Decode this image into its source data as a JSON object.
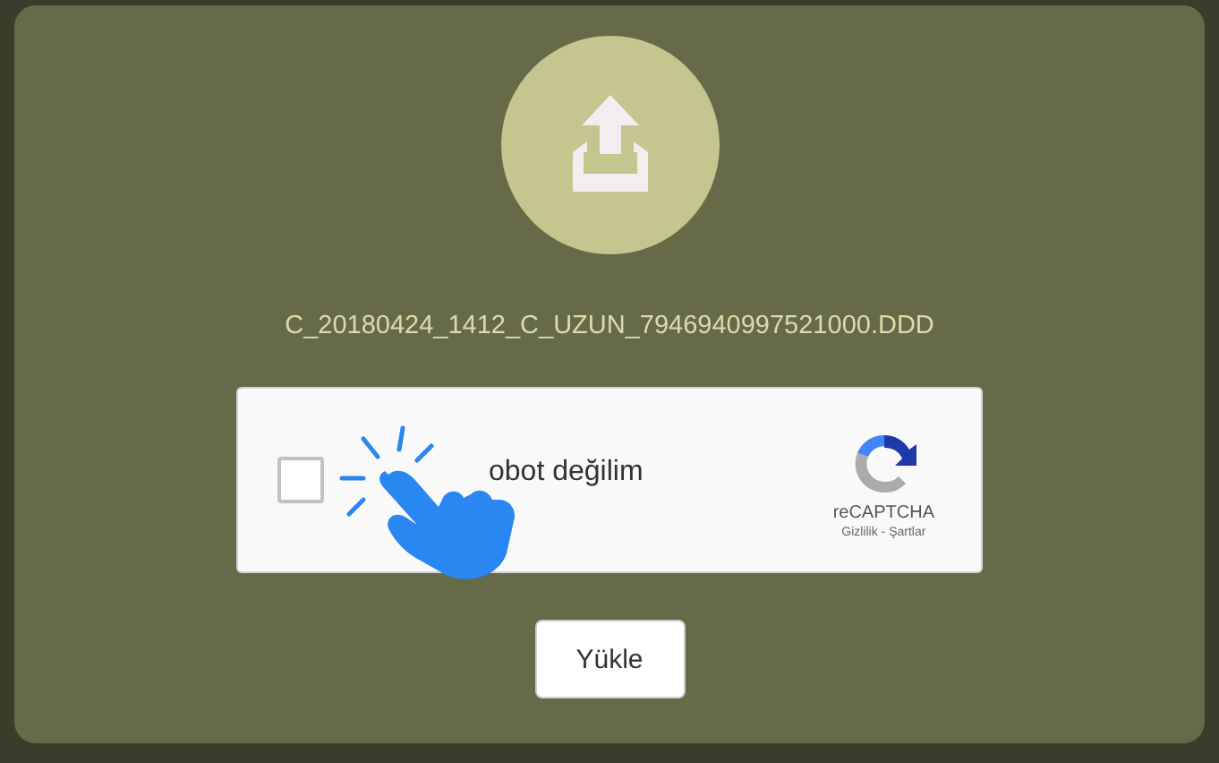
{
  "file_name": "C_20180424_1412_C_UZUN_7946940997521000.DDD",
  "captcha": {
    "checked": false,
    "label": "obot değilim",
    "brand": "reCAPTCHA",
    "links": "Gizlilik - Şartlar"
  },
  "submit_button": "Yükle"
}
